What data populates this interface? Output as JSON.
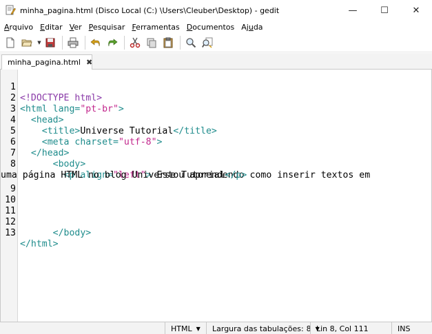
{
  "window": {
    "title": "minha_pagina.html (Disco Local (C:) \\Users\\Cleuber\\Desktop) - gedit",
    "minimize": "—",
    "maximize": "☐",
    "close": "✕"
  },
  "menu": [
    {
      "key": "A",
      "rest": "rquivo"
    },
    {
      "key": "E",
      "rest": "ditar"
    },
    {
      "key": "V",
      "rest": "er"
    },
    {
      "key": "P",
      "rest": "esquisar"
    },
    {
      "key": "F",
      "rest": "erramentas"
    },
    {
      "key": "D",
      "rest": "ocumentos"
    },
    {
      "key": "A",
      "rest": "juda",
      "prefix": ""
    }
  ],
  "menu_labels": {
    "arquivo_key": "A",
    "arquivo_rest": "rquivo",
    "editar_key": "E",
    "editar_rest": "ditar",
    "ver_key": "V",
    "ver_rest": "er",
    "pesquisar_key": "P",
    "pesquisar_rest": "esquisar",
    "ferramentas_key": "F",
    "ferramentas_rest": "erramentas",
    "documentos_key": "D",
    "documentos_rest": "ocumentos",
    "ajuda_pre": "Aj",
    "ajuda_key": "u",
    "ajuda_rest": "da"
  },
  "tab": {
    "label": "minha_pagina.html",
    "close": "✖"
  },
  "code": {
    "l1": {
      "num": "1",
      "a": "<!DOCTYPE html>"
    },
    "l2": {
      "num": "2",
      "a": "<html ",
      "b": "lang=",
      "c": "\"pt-br\"",
      "d": ">"
    },
    "l3": {
      "num": "3",
      "a": "<head>"
    },
    "l4": {
      "num": "4",
      "a": "<title>",
      "b": "Universe Tutorial",
      "c": "</title>"
    },
    "l5": {
      "num": "5",
      "a": "<meta ",
      "b": "charset=",
      "c": "\"utf-8\"",
      "d": ">"
    },
    "l6": {
      "num": "6",
      "a": "</head>"
    },
    "l7": {
      "num": "7",
      "a": "<body>"
    },
    "l8": {
      "num": "8",
      "a": "<p ",
      "b": "align=",
      "c": "\"left\"",
      "d": ">",
      "e": " Estou aprendendo como inserir textos em"
    },
    "l8b": {
      "a": "uma página HTML no blog Universe Tutorial",
      "b": "</p>"
    },
    "l9": {
      "num": "9"
    },
    "l10": {
      "num": "10"
    },
    "l11": {
      "num": "11"
    },
    "l12": {
      "num": "12",
      "a": "</body>"
    },
    "l13": {
      "num": "13",
      "a": "</html>"
    }
  },
  "status": {
    "language": "HTML",
    "tab_width_label": "Largura das tabulações:",
    "tab_width_value": "8",
    "position": "Lin 8, Col 111",
    "mode": "INS"
  }
}
